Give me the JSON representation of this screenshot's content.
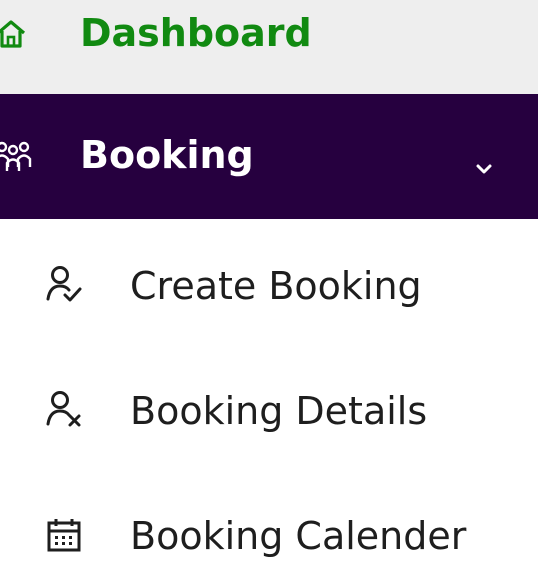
{
  "sidebar": {
    "items": [
      {
        "label": "Dashboard",
        "icon": "home-icon",
        "color": "#118a11",
        "background": "#eeeeee"
      },
      {
        "label": "Booking",
        "icon": "users-icon",
        "color": "#ffffff",
        "background": "#26003f",
        "expanded": true,
        "toggle_icon": "chevron-down-icon",
        "children": [
          {
            "label": "Create Booking",
            "icon": "user-check-icon"
          },
          {
            "label": "Booking Details",
            "icon": "user-x-icon"
          },
          {
            "label": "Booking Calender",
            "icon": "calendar-icon"
          }
        ]
      }
    ]
  }
}
